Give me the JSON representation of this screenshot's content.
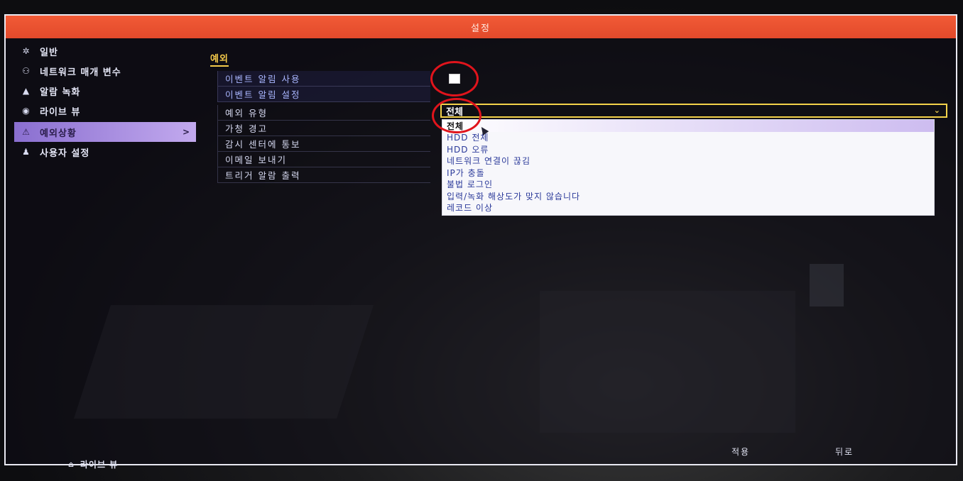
{
  "window": {
    "title": "설정"
  },
  "sidebar": {
    "items": [
      {
        "label": "일반",
        "icon": "gear-icon",
        "glyph": "✲"
      },
      {
        "label": "네트워크 매개 변수",
        "icon": "network-icon",
        "glyph": "⚇"
      },
      {
        "label": "알람 녹화",
        "icon": "alarm-icon",
        "glyph": "▲"
      },
      {
        "label": "라이브 뷰",
        "icon": "eye-icon",
        "glyph": "◉"
      },
      {
        "label": "예외상황",
        "icon": "warning-icon",
        "glyph": "⚠",
        "active": true,
        "chevron": ">"
      },
      {
        "label": "사용자 설정",
        "icon": "users-icon",
        "glyph": "♟"
      }
    ]
  },
  "section": {
    "title": "예외",
    "rows": [
      "이벤트 알림 사용",
      "이벤트 알림 설정",
      "예외 유형",
      "가청 경고",
      "감시 센터에 통보",
      "이메일 보내기",
      "트리거 알람 출력"
    ]
  },
  "controls": {
    "event_alert_enabled": false,
    "exception_type": {
      "selected": "전체",
      "arrow": "⌄",
      "options": [
        "전체",
        "HDD 전체",
        "HDD 오류",
        "네트워크 연결이 끊김",
        "IP가 충돌",
        "불법 로그인",
        "입력/녹화 해상도가 맞지 않습니다",
        "레코드 이상"
      ]
    }
  },
  "footer": {
    "apply_label": "적용",
    "back_label": "뒤로",
    "live_view_label": "라이브 뷰",
    "live_view_icon": "home-icon"
  },
  "colors": {
    "title_bar": "#e24a2b",
    "accent_yellow": "#f3d24a",
    "active_item": "#a88be2",
    "annotation_red": "#e0141c"
  }
}
